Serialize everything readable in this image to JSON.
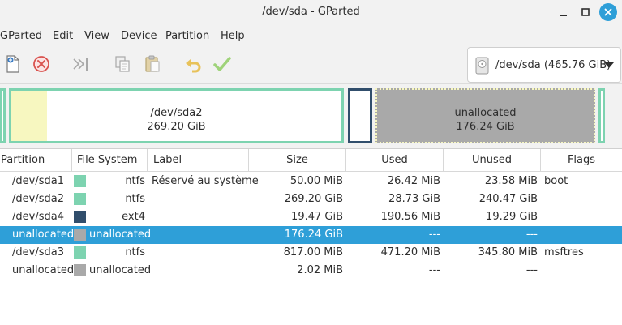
{
  "window": {
    "title": "/dev/sda - GParted"
  },
  "menu": [
    "GParted",
    "Edit",
    "View",
    "Device",
    "Partition",
    "Help"
  ],
  "toolbar": {
    "buttons": [
      "new-partition",
      "delete-partition",
      "resize-move",
      "copy",
      "paste",
      "undo",
      "apply"
    ]
  },
  "device": {
    "label": "/dev/sda (465.76 GiB)"
  },
  "map": {
    "sda2": {
      "name": "/dev/sda2",
      "size": "269.20 GiB"
    },
    "unallocated": {
      "name": "unallocated",
      "size": "176.24 GiB"
    }
  },
  "table": {
    "headers": [
      "Partition",
      "File System",
      "Label",
      "Size",
      "Used",
      "Unused",
      "Flags"
    ],
    "rows": [
      {
        "partition": "/dev/sda1",
        "fs": "ntfs",
        "fs_color": "#7dd3b0",
        "label": "Réservé au système",
        "size": "50.00 MiB",
        "used": "26.42 MiB",
        "unused": "23.58 MiB",
        "flags": "boot"
      },
      {
        "partition": "/dev/sda2",
        "fs": "ntfs",
        "fs_color": "#7dd3b0",
        "label": "",
        "size": "269.20 GiB",
        "used": "28.73 GiB",
        "unused": "240.47 GiB",
        "flags": ""
      },
      {
        "partition": "/dev/sda4",
        "fs": "ext4",
        "fs_color": "#314e6c",
        "label": "",
        "size": "19.47 GiB",
        "used": "190.56 MiB",
        "unused": "19.29 GiB",
        "flags": ""
      },
      {
        "partition": "unallocated",
        "fs": "unallocated",
        "fs_color": "#a9a9a9",
        "label": "",
        "size": "176.24 GiB",
        "used": "---",
        "unused": "---",
        "flags": ""
      },
      {
        "partition": "/dev/sda3",
        "fs": "ntfs",
        "fs_color": "#7dd3b0",
        "label": "",
        "size": "817.00 MiB",
        "used": "471.20 MiB",
        "unused": "345.80 MiB",
        "flags": "msftres"
      },
      {
        "partition": "unallocated",
        "fs": "unallocated",
        "fs_color": "#a9a9a9",
        "label": "",
        "size": "2.02 MiB",
        "used": "---",
        "unused": "---",
        "flags": ""
      }
    ],
    "selected_index": 3
  },
  "colors": {
    "ntfs": "#7dd3b0",
    "ext4": "#314e6c",
    "unallocated": "#a9a9a9",
    "selection": "#2e9fd8",
    "used_fill": "#f7f7c0"
  }
}
